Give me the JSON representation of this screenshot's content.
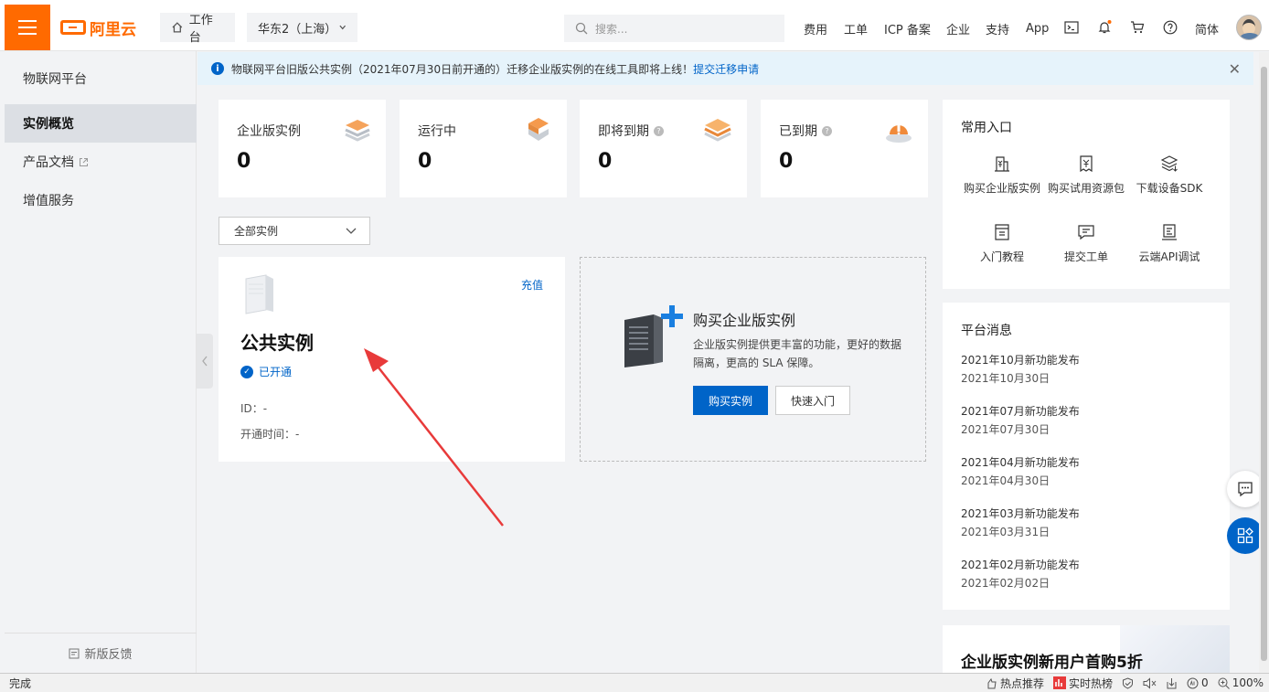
{
  "header": {
    "logo_text": "阿里云",
    "workbench_label": "工作台",
    "region_label": "华东2（上海）",
    "search_placeholder": "搜索...",
    "nav": [
      "费用",
      "工单",
      "ICP 备案",
      "企业",
      "支持",
      "App"
    ],
    "lang_label": "简体"
  },
  "sidebar": {
    "title": "物联网平台",
    "items": [
      {
        "label": "实例概览",
        "active": true
      },
      {
        "label": "产品文档",
        "active": false
      },
      {
        "label": "增值服务",
        "active": false
      }
    ],
    "feedback_label": "新版反馈"
  },
  "notice": {
    "text": "物联网平台旧版公共实例（2021年07月30日前开通的）迁移企业版实例的在线工具即将上线！",
    "link": "提交迁移申请"
  },
  "stats": [
    {
      "label": "企业版实例",
      "value": "0",
      "help": false
    },
    {
      "label": "运行中",
      "value": "0",
      "help": false
    },
    {
      "label": "即将到期",
      "value": "0",
      "help": true
    },
    {
      "label": "已到期",
      "value": "0",
      "help": true
    }
  ],
  "filter": {
    "selected": "全部实例"
  },
  "public_instance": {
    "recharge_label": "充值",
    "title": "公共实例",
    "status": "已开通",
    "id_line": "ID：-",
    "open_time_line": "开通时间：-"
  },
  "buy_card": {
    "title": "购买企业版实例",
    "desc": "企业版实例提供更丰富的功能，更好的数据隔离，更高的 SLA 保障。",
    "primary_label": "购买实例",
    "secondary_label": "快速入门"
  },
  "quick_entry": {
    "title": "常用入口",
    "items": [
      {
        "label": "购买企业版实例",
        "icon": "purchase-icon"
      },
      {
        "label": "购买试用资源包",
        "icon": "yen-document-icon"
      },
      {
        "label": "下载设备SDK",
        "icon": "layers-download-icon"
      },
      {
        "label": "入门教程",
        "icon": "tutorial-icon"
      },
      {
        "label": "提交工单",
        "icon": "ticket-icon"
      },
      {
        "label": "云端API调试",
        "icon": "api-debug-icon"
      }
    ]
  },
  "platform_news": {
    "title": "平台消息",
    "items": [
      {
        "title": "2021年10月新功能发布",
        "date": "2021年10月30日"
      },
      {
        "title": "2021年07月新功能发布",
        "date": "2021年07月30日"
      },
      {
        "title": "2021年04月新功能发布",
        "date": "2021年04月30日"
      },
      {
        "title": "2021年03月新功能发布",
        "date": "2021年03月31日"
      },
      {
        "title": "2021年02月新功能发布",
        "date": "2021年02月02日"
      }
    ]
  },
  "promo": {
    "title": "企业版实例新用户首购5折"
  },
  "statusbar": {
    "left": "完成",
    "hot_recommend": "热点推荐",
    "realtime_hot": "实时热榜",
    "count": "0",
    "zoom": "100%"
  },
  "colors": {
    "brand": "#ff6a00",
    "primary": "#0064c8",
    "notice_bg": "#e6f3fb"
  }
}
